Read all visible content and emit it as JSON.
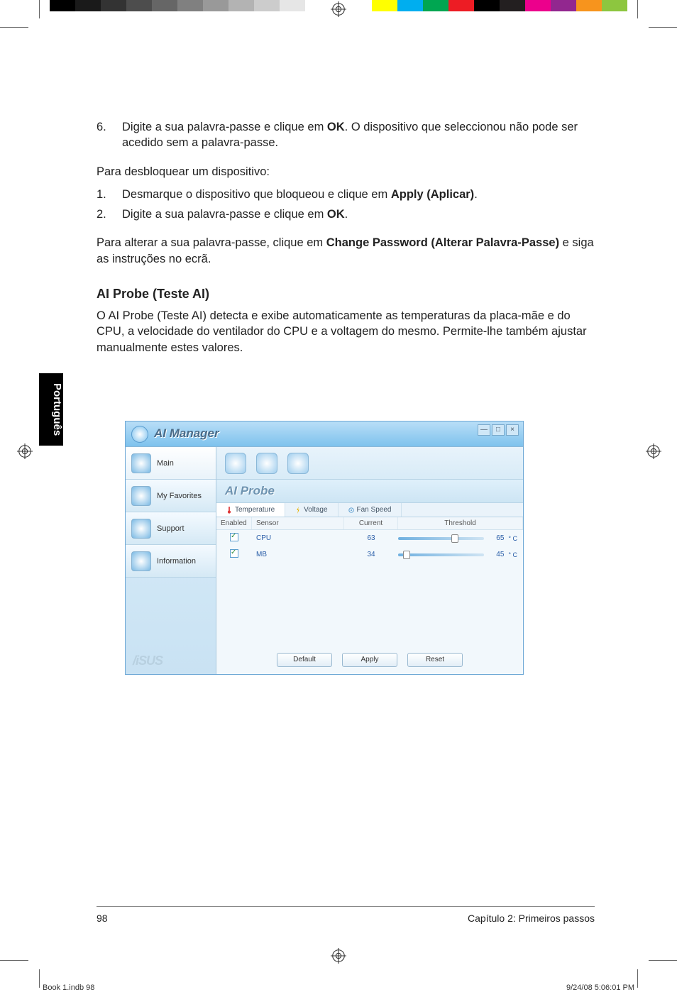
{
  "printer": {
    "grays": [
      "#000000",
      "#1a1a1a",
      "#333333",
      "#4d4d4d",
      "#666666",
      "#808080",
      "#999999",
      "#b3b3b3",
      "#cccccc",
      "#e6e6e6",
      "#ffffff"
    ],
    "colors": [
      "#ffff00",
      "#00aeef",
      "#00a651",
      "#ed1c24",
      "#000000",
      "#231f20",
      "#ec008c",
      "#92278f",
      "#f7941d",
      "#8dc63f"
    ]
  },
  "body": {
    "step6_num": "6.",
    "step6_a": "Digite a sua palavra-passe e clique em ",
    "step6_bold": "OK",
    "step6_b": ". O dispositivo que seleccionou não pode ser acedido sem a palavra-passe.",
    "unlock_intro": "Para desbloquear um dispositivo:",
    "u1_num": "1.",
    "u1_a": "Desmarque o dispositivo que bloqueou e clique em ",
    "u1_bold": "Apply (Aplicar)",
    "u1_b": ".",
    "u2_num": "2.",
    "u2_a": "Digite a sua palavra-passe e clique em ",
    "u2_bold": "OK",
    "u2_b": ".",
    "change_a": "Para alterar a sua palavra-passe, clique em ",
    "change_bold": "Change Password (Alterar Palavra-Passe)",
    "change_b": " e siga as instruções no ecrã.",
    "heading": "AI Probe (Teste AI)",
    "desc": "O AI Probe (Teste AI) detecta e exibe automaticamente as temperaturas da placa-mãe e do CPU, a velocidade do ventilador do CPU e a voltagem do mesmo. Permite-lhe também ajustar manualmente estes valores."
  },
  "lang_tab": "Português",
  "shot": {
    "title": "AI Manager",
    "win_min": "—",
    "win_max": "□",
    "win_close": "×",
    "sidebar": {
      "main": "Main",
      "fav": "My Favorites",
      "support": "Support",
      "info": "Information",
      "brand": "/iSUS"
    },
    "panel_title": "AI Probe",
    "tabs": {
      "temp": "Temperature",
      "volt": "Voltage",
      "fan": "Fan Speed"
    },
    "grid": {
      "h_enabled": "Enabled",
      "h_sensor": "Sensor",
      "h_current": "Current",
      "h_threshold": "Threshold",
      "rows": [
        {
          "sensor": "CPU",
          "current": "63",
          "threshold": "65",
          "unit": "° C",
          "thumb": 62
        },
        {
          "sensor": "MB",
          "current": "34",
          "threshold": "45",
          "unit": "° C",
          "thumb": 6
        }
      ]
    },
    "buttons": {
      "default": "Default",
      "apply": "Apply",
      "reset": "Reset"
    }
  },
  "footer": {
    "page_num": "98",
    "chapter": "Capítulo 2: Primeiros passos"
  },
  "slug": {
    "file": "Book 1.indb   98",
    "stamp": "9/24/08   5:06:01 PM"
  }
}
